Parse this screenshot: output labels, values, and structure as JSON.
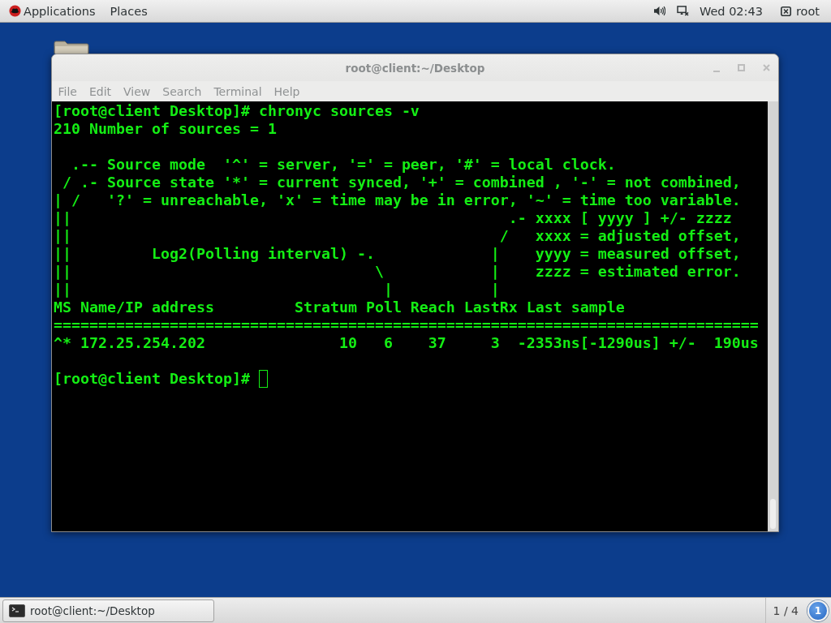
{
  "top_bar": {
    "menus": [
      {
        "label": "Applications"
      },
      {
        "label": "Places"
      }
    ],
    "clock": "Wed 02:43",
    "user": "root"
  },
  "window": {
    "title": "root@client:~/Desktop",
    "focused": false,
    "menu": [
      "File",
      "Edit",
      "View",
      "Search",
      "Terminal",
      "Help"
    ],
    "terminal": {
      "blocks": [
        {
          "lines": [
            "[root@client Desktop]# chronyc sources -v",
            "210 Number of sources = 1"
          ]
        },
        {
          "lines": [
            "  .-- Source mode  '^' = server, '=' = peer, '#' = local clock.",
            " / .- Source state '*' = current synced, '+' = combined , '-' = not combined,",
            "| /   '?' = unreachable, 'x' = time may be in error, '~' = time too variable.",
            "||                                                 .- xxxx [ yyyy ] +/- zzzz",
            "||                                                /   xxxx = adjusted offset,",
            "||         Log2(Polling interval) -.             |    yyyy = measured offset,",
            "||                                  \\            |    zzzz = estimated error.",
            "||                                   |           |",
            "MS Name/IP address         Stratum Poll Reach LastRx Last sample",
            "===============================================================================",
            "^* 172.25.254.202               10   6    37     3  -2353ns[-1290us] +/-  190us"
          ]
        }
      ],
      "prompt": "[root@client Desktop]#"
    }
  },
  "taskbar": {
    "windows": [
      {
        "label": "root@client:~/Desktop",
        "selected": false
      }
    ],
    "workspace": "1 / 4",
    "notifications": "1"
  }
}
